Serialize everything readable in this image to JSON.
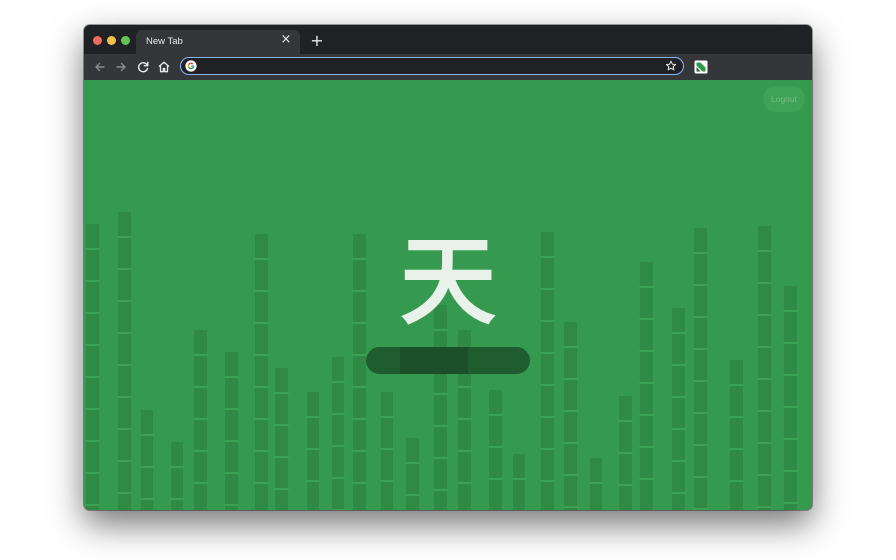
{
  "browser": {
    "tab": {
      "title": "New Tab",
      "close_icon": "close-icon"
    },
    "new_tab_icon": "plus-icon",
    "toolbar": {
      "back_icon": "arrow-left-icon",
      "forward_icon": "arrow-right-icon",
      "reload_icon": "reload-icon",
      "home_icon": "home-icon",
      "omnibox_value": "",
      "omnibox_icon": "google-g-icon",
      "bookmark_icon": "star-icon",
      "extension_icon": "extension-icon"
    },
    "colors": {
      "frame": "#202124",
      "toolbar": "#35363a",
      "omnibox_focus": "#8ab4f8"
    }
  },
  "page": {
    "logout_label": "Logout",
    "character": "天",
    "answer_value": "",
    "background_color": "#359a4f",
    "bamboo_color": "#2e8a45",
    "decoration": "bamboo stalks"
  }
}
